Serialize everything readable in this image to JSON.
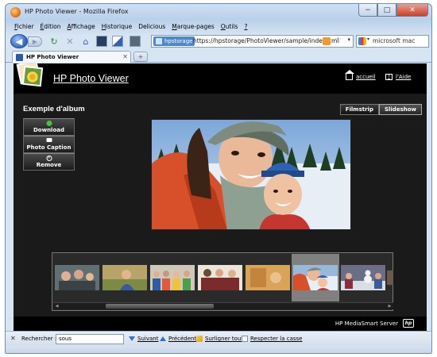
{
  "window": {
    "title": "HP Photo Viewer - Mozilla Firefox",
    "controls": {
      "minimize": "−",
      "maximize": "□",
      "close": "✕"
    }
  },
  "menu": {
    "items": [
      {
        "label": "Fichier",
        "accel": "F"
      },
      {
        "label": "Édition",
        "accel": "É"
      },
      {
        "label": "Affichage",
        "accel": "A"
      },
      {
        "label": "Historique",
        "accel": "H"
      },
      {
        "label": "Delicious",
        "accel": ""
      },
      {
        "label": "Marque-pages",
        "accel": "M"
      },
      {
        "label": "Outils",
        "accel": "O"
      },
      {
        "label": "?",
        "accel": "?"
      }
    ]
  },
  "navigation": {
    "site_label": "hpstorage",
    "url": "https://hpstorage/PhotoViewer/sample/index.xml",
    "search_value": "microsoft mac"
  },
  "tabs": [
    {
      "label": "HP Photo Viewer"
    }
  ],
  "app": {
    "title": "HP Photo Viewer",
    "home_link": "accueil",
    "help_link": "l'Aide",
    "album_title": "Exemple d'album",
    "view_modes": [
      "Filmstrip",
      "Slideshow"
    ],
    "actions": {
      "download": "Download",
      "caption": "Photo Caption",
      "remove": "Remove"
    },
    "footer": "HP MediaSmart Server",
    "footer_logo": "hp"
  },
  "filmstrip": {
    "thumbnails": [
      {
        "subject": "family-group"
      },
      {
        "subject": "woman-outdoors"
      },
      {
        "subject": "group-portrait"
      },
      {
        "subject": "friends-on-couch"
      },
      {
        "subject": "warm-interior"
      },
      {
        "subject": "mother-and-child-snow"
      },
      {
        "subject": "kids-with-snowman"
      },
      {
        "subject": "partial"
      }
    ],
    "selected_index": 5
  },
  "findbar": {
    "close": "✕",
    "label": "Rechercher :",
    "query": "sous",
    "next": "Suivant",
    "previous": "Précédent",
    "highlight_all": "Surligner tout",
    "match_case": "Respecter la casse"
  },
  "colors": {
    "page_background": "#1a1a1a",
    "header_background": "#000000",
    "selected_thumb": "#808080",
    "browser_chrome": "#c6d8ee"
  }
}
